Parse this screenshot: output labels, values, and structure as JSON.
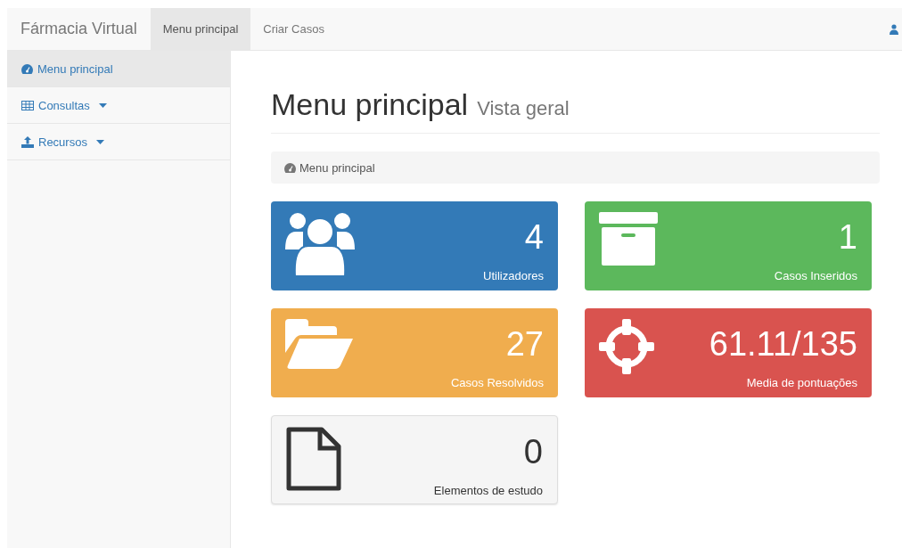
{
  "navbar": {
    "brand": "Fármacia Virtual",
    "tabs": [
      {
        "label": "Menu principal",
        "selected": true
      },
      {
        "label": "Criar Casos",
        "selected": false
      }
    ]
  },
  "sidebar": {
    "items": [
      {
        "label": "Menu principal",
        "kind": "dashboard",
        "selected": true,
        "dropdown": false
      },
      {
        "label": "Consultas",
        "kind": "table",
        "selected": false,
        "dropdown": true
      },
      {
        "label": "Recursos",
        "kind": "upload",
        "selected": false,
        "dropdown": true
      }
    ]
  },
  "header": {
    "title": "Menu principal",
    "subtitle": "Vista geral"
  },
  "breadcrumb": {
    "label": "Menu principal"
  },
  "cards": [
    {
      "kind": "users",
      "value": "4",
      "label": "Utilizadores",
      "color": "#337ab7"
    },
    {
      "kind": "archive",
      "value": "1",
      "label": "Casos Inseridos",
      "color": "#5cb85c"
    },
    {
      "kind": "folder",
      "value": "27",
      "label": "Casos Resolvidos",
      "color": "#f0ad4e"
    },
    {
      "kind": "crosshair",
      "value": "61.11/135",
      "label": "Media de pontuações",
      "color": "#d9534f"
    },
    {
      "kind": "file",
      "value": "0",
      "label": "Elementos de estudo",
      "color": "#f5f5f5"
    }
  ]
}
